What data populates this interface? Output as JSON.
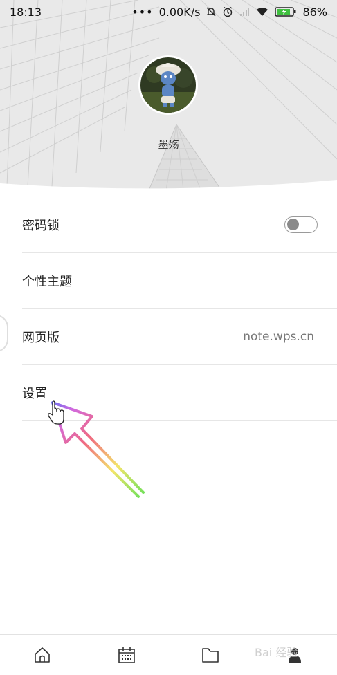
{
  "status_bar": {
    "time": "18:13",
    "speed": "0.00K/s",
    "battery": "86%"
  },
  "profile": {
    "username": "墨殇",
    "avatar_icon": "smurf-avatar-icon"
  },
  "menu": {
    "password_lock": {
      "label": "密码锁",
      "toggle_on": false
    },
    "theme": {
      "label": "个性主题"
    },
    "web_version": {
      "label": "网页版",
      "value": "note.wps.cn"
    },
    "settings": {
      "label": "设置"
    }
  },
  "bottom_nav": {
    "tabs": [
      "home-icon",
      "calendar-icon",
      "folder-icon",
      "profile-icon"
    ]
  },
  "watermark": {
    "text": "Bai 经验"
  },
  "colors": {
    "header_bg": "#e9e9e9",
    "divider": "#e6e6e6",
    "text": "#222222",
    "muted": "#777777"
  }
}
